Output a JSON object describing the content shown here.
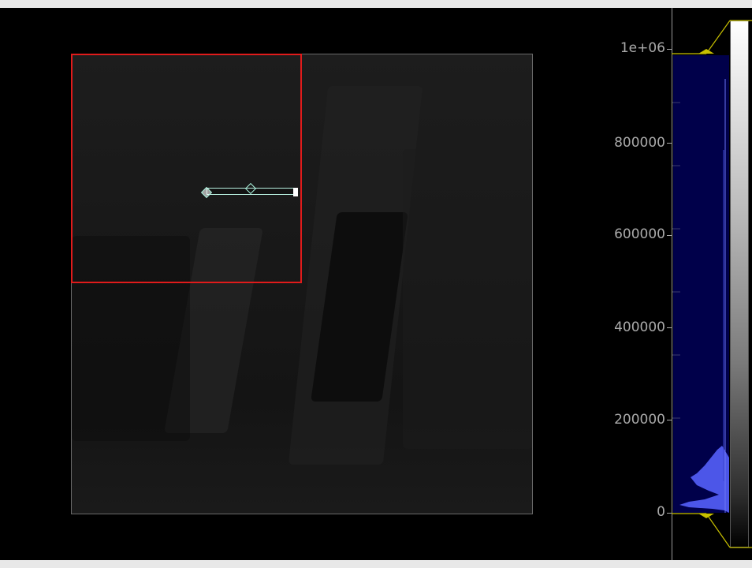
{
  "viewer": {
    "background": "#000000",
    "roi_color": "#e01b1b",
    "line_roi_color": "#b8f0e0"
  },
  "histogram": {
    "fill_color": "#00004a",
    "trace_color": "#4c56e8",
    "level_line_color": "#c8c000",
    "gradient": "grayscale",
    "y_axis_ticks": [
      "1e+06",
      "800000",
      "600000",
      "400000",
      "200000",
      "0"
    ],
    "y_axis_range": [
      0,
      1000000
    ]
  },
  "icons": {
    "roi_handle": "diamond-handle-icon",
    "line_end": "resize-handle-icon"
  }
}
